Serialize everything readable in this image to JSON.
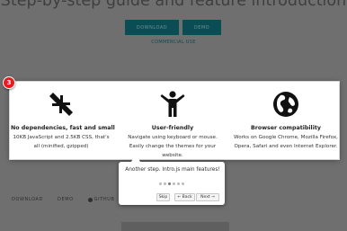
{
  "page": {
    "hero_title": "Step-by-step guide and feature introduction",
    "download_button": "DOWNLOAD",
    "demo_button": "DEMO",
    "commercial_link": "COMMERCIAL USE"
  },
  "footer": {
    "download": "DOWNLOAD",
    "demo": "DEMO",
    "github": "GITHUB"
  },
  "step_badge": "3",
  "features": [
    {
      "icon": "compress-arrows-icon",
      "title": "No dependencies, fast and small",
      "description": "10KB JavaScript and 2.5KB CSS, that's all (minified, gzipped)"
    },
    {
      "icon": "person-icon",
      "title": "User-friendly",
      "description": "Navigate using keyboard or mouse. Easily change the themes for your website."
    },
    {
      "icon": "globe-icon",
      "title": "Browser compatibility",
      "description": "Works on Google Chrome, Mozilla Firefox, Opera, Safari and even Internet Explorer."
    }
  ],
  "tooltip": {
    "text": "Another step. Intro.js main features!",
    "total_steps": 6,
    "current_step": 3,
    "skip_label": "Skip",
    "back_label": "← Back",
    "next_label": "Next →"
  },
  "colors": {
    "overlay": "#6f6f6f",
    "button": "#0a4d55",
    "badge": "#e31d1d"
  }
}
